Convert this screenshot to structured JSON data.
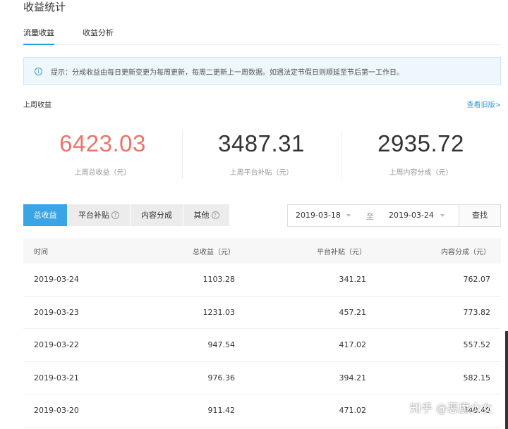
{
  "page": {
    "title": "收益统计"
  },
  "tabs": [
    {
      "label": "流量收益"
    },
    {
      "label": "收益分析"
    }
  ],
  "notice": {
    "text": "提示：分成收益由每日更新变更为每周更新，每周二更新上一周数据。如遇法定节假日则顺延至节后第一工作日。"
  },
  "section": {
    "label": "上周收益",
    "old_link": "查看旧版>"
  },
  "stats": [
    {
      "value": "6423.03",
      "label": "上周总收益（元）"
    },
    {
      "value": "3487.31",
      "label": "上周平台补贴（元）"
    },
    {
      "value": "2935.72",
      "label": "上周内容分成（元）"
    }
  ],
  "filters": [
    {
      "label": "总收益"
    },
    {
      "label": "平台补贴"
    },
    {
      "label": "内容分成"
    },
    {
      "label": "其他"
    }
  ],
  "help_glyph": "?",
  "date_range": {
    "from": "2019-03-18",
    "separator": "至",
    "to": "2019-03-24",
    "search_label": "查找"
  },
  "table": {
    "headers": [
      "时间",
      "总收益（元）",
      "平台补贴（元）",
      "内容分成（元）"
    ],
    "rows": [
      [
        "2019-03-24",
        "1103.28",
        "341.21",
        "762.07"
      ],
      [
        "2019-03-23",
        "1231.03",
        "457.21",
        "773.82"
      ],
      [
        "2019-03-22",
        "947.54",
        "417.02",
        "557.52"
      ],
      [
        "2019-03-21",
        "976.36",
        "394.21",
        "582.15"
      ],
      [
        "2019-03-20",
        "911.42",
        "471.02",
        "440.40"
      ]
    ]
  },
  "watermark": "知乎 @恶魔少女",
  "colors": {
    "accent": "#3aa5e6",
    "highlight": "#e8756a",
    "notice_bg": "#eef7fc"
  }
}
